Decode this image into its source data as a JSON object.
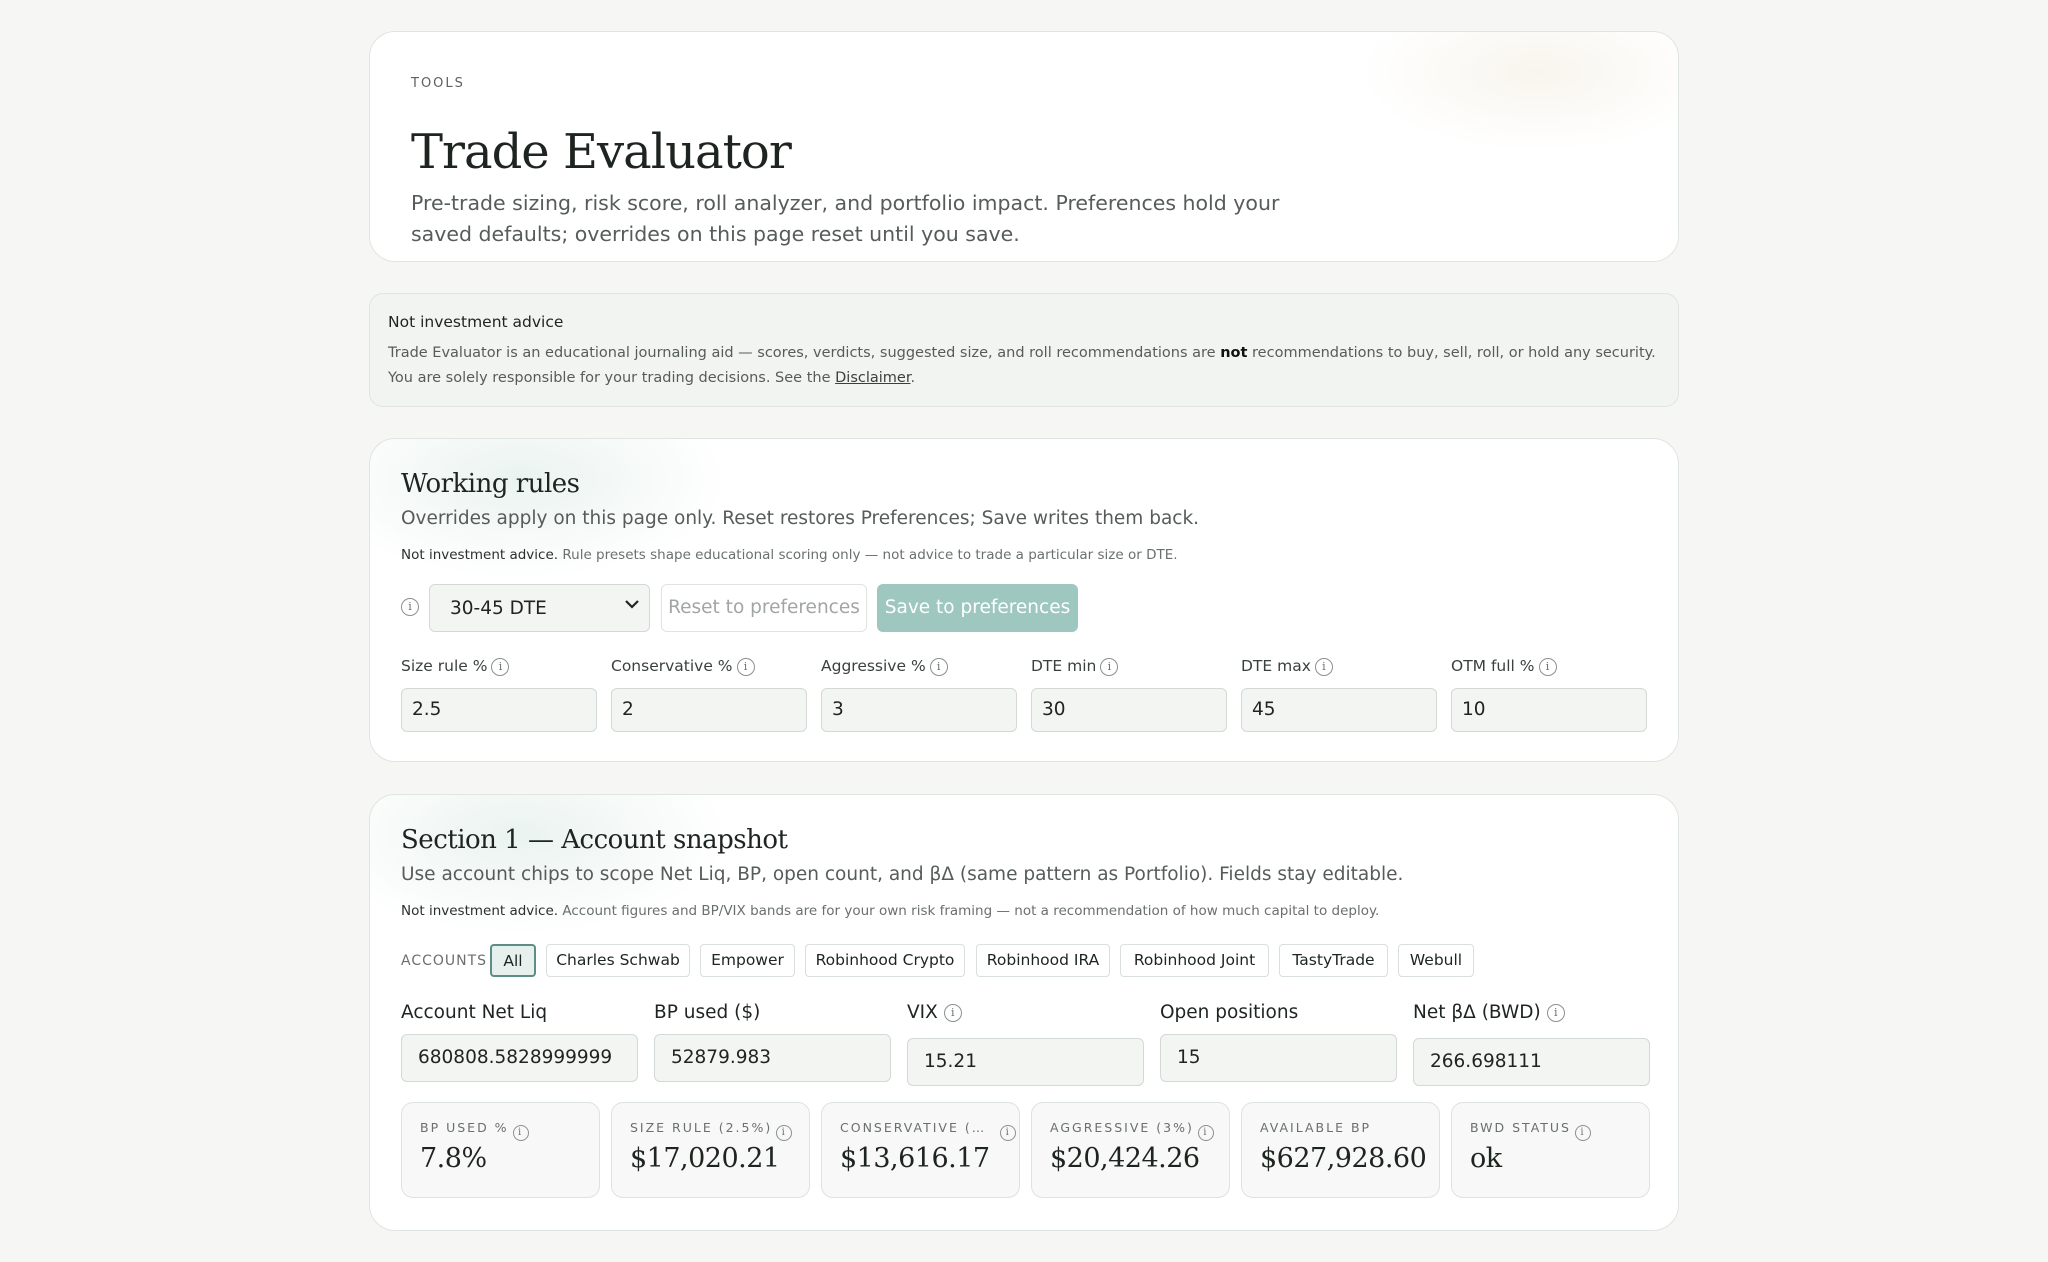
{
  "header": {
    "eyebrow": "TOOLS",
    "title": "Trade Evaluator",
    "subtitle": "Pre-trade sizing, risk score, roll analyzer, and portfolio impact. Preferences hold your saved defaults; overrides on this page reset until you save."
  },
  "advice": {
    "title": "Not investment advice",
    "body_before": "Trade Evaluator is an educational journaling aid — scores, verdicts, suggested size, and roll recommendations are ",
    "body_bold": "not",
    "body_after": " recommendations to buy, sell, roll, or hold any security. You are solely responsible for your trading decisions. See the ",
    "link": "Disclaimer",
    "end": "."
  },
  "rules": {
    "title": "Working rules",
    "subtitle": "Overrides apply on this page only. Reset restores Preferences; Save writes them back.",
    "note_bold": "Not investment advice.",
    "note": " Rule presets shape educational scoring only — not advice to trade a particular size or DTE.",
    "preset": "30-45 DTE",
    "reset_label": "Reset to preferences",
    "save_label": "Save to preferences",
    "fields": [
      {
        "label": "Size rule %",
        "value": "2.5"
      },
      {
        "label": "Conservative %",
        "value": "2"
      },
      {
        "label": "Aggressive %",
        "value": "3"
      },
      {
        "label": "DTE min",
        "value": "30"
      },
      {
        "label": "DTE max",
        "value": "45"
      },
      {
        "label": "OTM full %",
        "value": "10"
      }
    ]
  },
  "snapshot": {
    "title": "Section 1 — Account snapshot",
    "subtitle": "Use account chips to scope Net Liq, BP, open count, and βΔ (same pattern as Portfolio). Fields stay editable.",
    "note_bold": "Not investment advice.",
    "note": " Account figures and BP/VIX bands are for your own risk framing — not a recommendation of how much capital to deploy.",
    "accounts_label": "ACCOUNTS",
    "accounts": [
      "All",
      "Charles Schwab",
      "Empower",
      "Robinhood Crypto",
      "Robinhood IRA",
      "Robinhood Joint",
      "TastyTrade",
      "Webull"
    ],
    "fields": [
      {
        "label": "Account Net Liq",
        "value": "680808.5828999999"
      },
      {
        "label": "BP used ($)",
        "value": "52879.983"
      },
      {
        "label": "VIX",
        "value": "15.21"
      },
      {
        "label": "Open positions",
        "value": "15"
      },
      {
        "label": "Net βΔ (BWD)",
        "value": "266.698111"
      }
    ],
    "metrics": [
      {
        "label": "BP USED %",
        "value": "7.8%"
      },
      {
        "label": "SIZE RULE (2.5%)",
        "value": "$17,020.21"
      },
      {
        "label": "CONSERVATIVE (…",
        "value": "$13,616.17"
      },
      {
        "label": "AGGRESSIVE (3%)",
        "value": "$20,424.26"
      },
      {
        "label": "AVAILABLE BP",
        "value": "$627,928.60"
      },
      {
        "label": "BWD STATUS",
        "value": "ok"
      }
    ]
  },
  "icons": {
    "info": "i",
    "chevron": "⌄"
  }
}
